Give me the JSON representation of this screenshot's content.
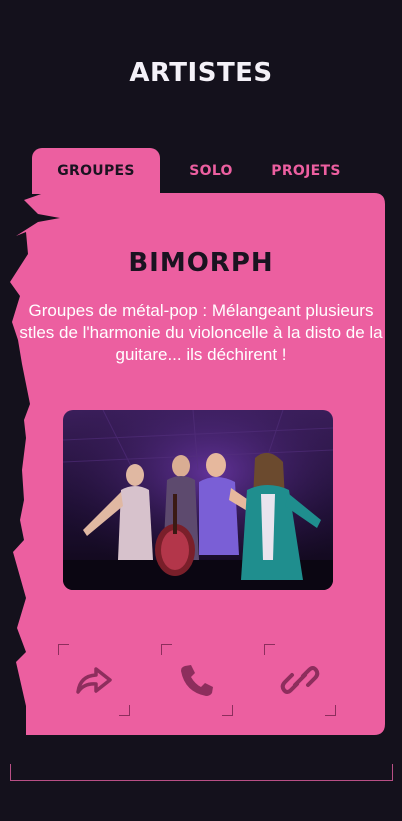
{
  "header": {
    "title": "ARTISTES"
  },
  "tabs": [
    {
      "label": "GROUPES",
      "active": true
    },
    {
      "label": "SOLO",
      "active": false
    },
    {
      "label": "PROJETS",
      "active": false
    }
  ],
  "artist": {
    "name": "BIMORPH",
    "description": "Groupes de métal-pop : Mélangeant plusieurs stles de l'harmonie du violoncelle à la disto de la guitare... ils déchirent !"
  },
  "actions": [
    {
      "icon": "share-icon"
    },
    {
      "icon": "phone-icon"
    },
    {
      "icon": "link-icon"
    }
  ],
  "colors": {
    "background": "#14111c",
    "accent": "#ec5fa0",
    "dark_text": "#1a1320",
    "icon": "#8d2e5d"
  }
}
